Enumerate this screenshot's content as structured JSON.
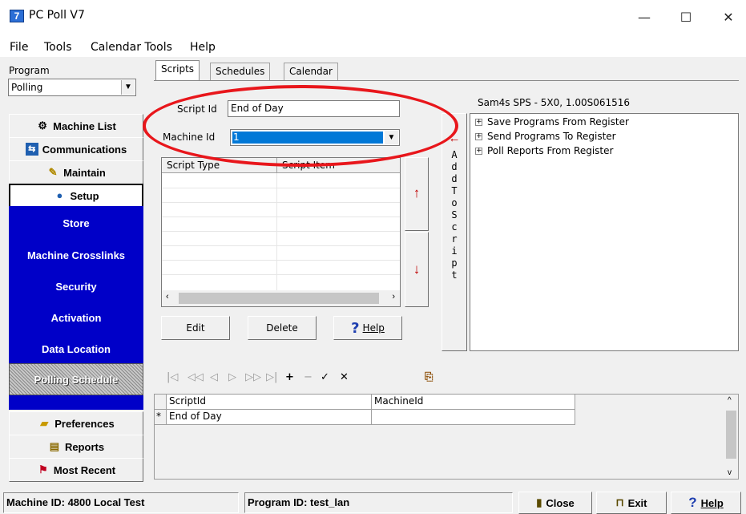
{
  "window": {
    "title": "PC Poll V7",
    "icon": "app-icon",
    "min": "—",
    "max": "☐",
    "close": "✕"
  },
  "menu": [
    "File",
    "Tools",
    "Calendar Tools",
    "Help"
  ],
  "left": {
    "program_label": "Program",
    "program_value": "Polling",
    "nav": [
      {
        "label": "Machine List",
        "icon": "gear-icon"
      },
      {
        "label": "Communications",
        "icon": "network-icon"
      },
      {
        "label": "Maintain",
        "icon": "wrench-icon"
      },
      {
        "label": "Setup",
        "icon": "globe-icon"
      }
    ],
    "submenu": [
      "Store",
      "Machine Crosslinks",
      "Security",
      "Activation",
      "Data Location",
      "Polling Schedule"
    ],
    "bottom_nav": [
      {
        "label": "Preferences",
        "icon": "folder-icon"
      },
      {
        "label": "Reports",
        "icon": "report-icon"
      },
      {
        "label": "Most Recent",
        "icon": "flag-icon"
      }
    ]
  },
  "tabs": [
    "Scripts",
    "Schedules",
    "Calendar"
  ],
  "form": {
    "script_id_label": "Script Id",
    "script_id_value": "End of Day",
    "machine_id_label": "Machine Id",
    "machine_id_value": "1"
  },
  "script_grid": {
    "columns": [
      "Script Type",
      "Script Item"
    ]
  },
  "buttons": {
    "edit": "Edit",
    "delete": "Delete",
    "help": "Help",
    "help_glyph": "?"
  },
  "add_script": {
    "arrow": "←",
    "letters": "A d d  T o  S c r i p t"
  },
  "move_up": "↑",
  "move_down": "↓",
  "tree": {
    "title": "Sam4s SPS - 5X0, 1.00S061516",
    "items": [
      "Save Programs From Register",
      "Send Programs To Register",
      "Poll Reports From Register"
    ]
  },
  "navigator": [
    "|◁",
    "◁◁",
    "◁",
    "▷",
    "▷▷",
    "▷|",
    "+",
    "−",
    "✓",
    "✕",
    "⎘"
  ],
  "bottom_grid": {
    "columns": [
      "ScriptId",
      "MachineId"
    ],
    "row_marker": "*",
    "rows": [
      [
        "End of Day",
        ""
      ]
    ]
  },
  "status": {
    "machine": "Machine ID: 4800 Local Test",
    "program": "Program ID: test_lan",
    "close": "Close",
    "exit": "Exit",
    "help": "Help"
  },
  "colors": {
    "accent": "#0000c8",
    "annotation": "#e8161b",
    "selection": "#0078d7"
  }
}
